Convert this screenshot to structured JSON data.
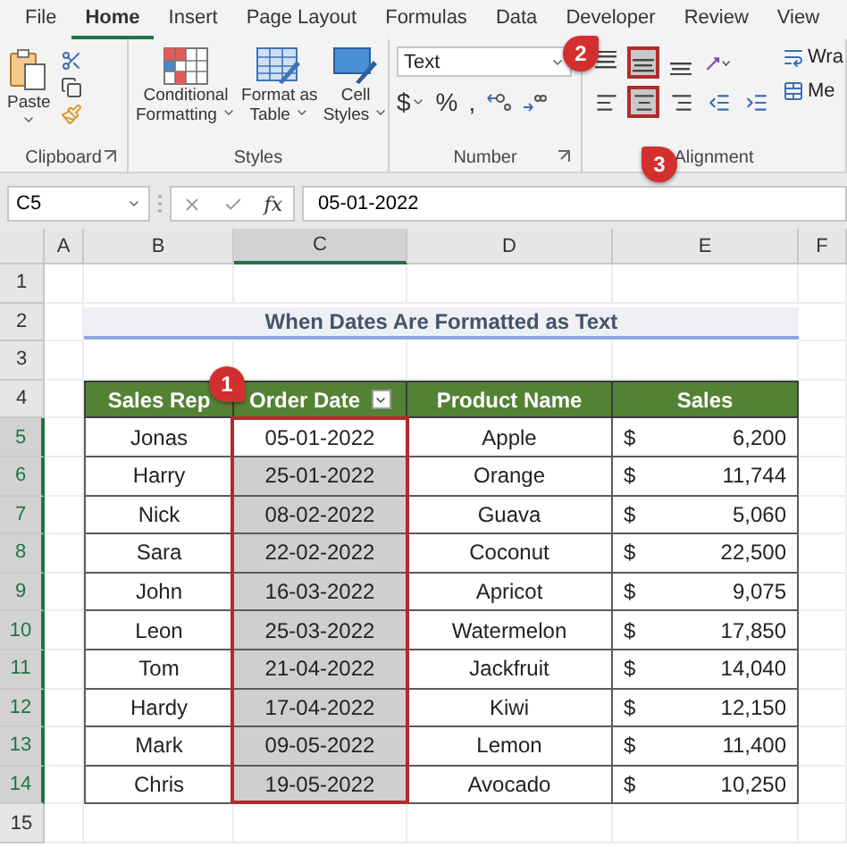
{
  "tabs": [
    {
      "label": "File",
      "selected": false
    },
    {
      "label": "Home",
      "selected": true
    },
    {
      "label": "Insert",
      "selected": false
    },
    {
      "label": "Page Layout",
      "selected": false
    },
    {
      "label": "Formulas",
      "selected": false
    },
    {
      "label": "Data",
      "selected": false
    },
    {
      "label": "Developer",
      "selected": false
    },
    {
      "label": "Review",
      "selected": false
    },
    {
      "label": "View",
      "selected": false
    }
  ],
  "ribbon": {
    "clipboard": {
      "paste": "Paste",
      "group_label": "Clipboard"
    },
    "styles": {
      "buttons": [
        {
          "kind": "conditional",
          "lines": [
            "Conditional",
            "Formatting"
          ]
        },
        {
          "kind": "table",
          "lines": [
            "Format as",
            "Table"
          ]
        },
        {
          "kind": "cell",
          "lines": [
            "Cell",
            "Styles"
          ]
        }
      ],
      "group_label": "Styles"
    },
    "number": {
      "format": "Text",
      "symbols": [
        {
          "text": "$",
          "caret": true
        },
        {
          "text": "%",
          "caret": false
        },
        {
          "text": ",",
          "caret": false
        }
      ],
      "group_label": "Number"
    },
    "alignment": {
      "top_row": [
        {
          "kind": "top",
          "highlighted": false
        },
        {
          "kind": "middle",
          "highlighted": true,
          "badge": "2"
        },
        {
          "kind": "bottom",
          "highlighted": false
        },
        {
          "kind": "orientation",
          "highlighted": false
        }
      ],
      "bottom_row": [
        {
          "kind": "left",
          "highlighted": false
        },
        {
          "kind": "center",
          "highlighted": true,
          "badge": "3"
        },
        {
          "kind": "right",
          "highlighted": false
        },
        {
          "kind": "outdent",
          "highlighted": false
        },
        {
          "kind": "indent",
          "highlighted": false
        }
      ],
      "wrap_text": "Wra",
      "merge": "Me",
      "group_label": "Alignment"
    }
  },
  "formula_bar": {
    "name_box": "C5",
    "function_label": "fx",
    "value": "05-01-2022"
  },
  "columns": [
    {
      "label": "A",
      "selected": false
    },
    {
      "label": "B",
      "selected": false
    },
    {
      "label": "C",
      "selected": true
    },
    {
      "label": "D",
      "selected": false
    },
    {
      "label": "E",
      "selected": false
    },
    {
      "label": "F",
      "selected": false
    }
  ],
  "row_numbers": [
    {
      "label": "1",
      "selected": false
    },
    {
      "label": "2",
      "selected": false
    },
    {
      "label": "3",
      "selected": false
    },
    {
      "label": "4",
      "selected": false
    },
    {
      "label": "5",
      "selected": true
    },
    {
      "label": "6",
      "selected": true
    },
    {
      "label": "7",
      "selected": true
    },
    {
      "label": "8",
      "selected": true
    },
    {
      "label": "9",
      "selected": true
    },
    {
      "label": "10",
      "selected": true
    },
    {
      "label": "11",
      "selected": true
    },
    {
      "label": "12",
      "selected": true
    },
    {
      "label": "13",
      "selected": true
    },
    {
      "label": "14",
      "selected": true
    },
    {
      "label": "15",
      "selected": false
    }
  ],
  "title": "When Dates Are Formatted as Text",
  "table": {
    "columns": [
      {
        "label": "Sales Rep",
        "filter": false
      },
      {
        "label": "Order Date",
        "filter": true
      },
      {
        "label": "Product Name",
        "filter": false
      },
      {
        "label": "Sales",
        "filter": false
      }
    ],
    "rows": [
      {
        "rep": "Jonas",
        "date": "05-01-2022",
        "selected": true,
        "active": true,
        "product": "Apple",
        "currency": "$",
        "amount": "6,200"
      },
      {
        "rep": "Harry",
        "date": "25-01-2022",
        "selected": true,
        "active": false,
        "product": "Orange",
        "currency": "$",
        "amount": "11,744"
      },
      {
        "rep": "Nick",
        "date": "08-02-2022",
        "selected": true,
        "active": false,
        "product": "Guava",
        "currency": "$",
        "amount": "5,060"
      },
      {
        "rep": "Sara",
        "date": "22-02-2022",
        "selected": true,
        "active": false,
        "product": "Coconut",
        "currency": "$",
        "amount": "22,500"
      },
      {
        "rep": "John",
        "date": "16-03-2022",
        "selected": true,
        "active": false,
        "product": "Apricot",
        "currency": "$",
        "amount": "9,075"
      },
      {
        "rep": "Leon",
        "date": "25-03-2022",
        "selected": true,
        "active": false,
        "product": "Watermelon",
        "currency": "$",
        "amount": "17,850"
      },
      {
        "rep": "Tom",
        "date": "21-04-2022",
        "selected": true,
        "active": false,
        "product": "Jackfruit",
        "currency": "$",
        "amount": "14,040"
      },
      {
        "rep": "Hardy",
        "date": "17-04-2022",
        "selected": true,
        "active": false,
        "product": "Kiwi",
        "currency": "$",
        "amount": "12,150"
      },
      {
        "rep": "Mark",
        "date": "09-05-2022",
        "selected": true,
        "active": false,
        "product": "Lemon",
        "currency": "$",
        "amount": "11,400"
      },
      {
        "rep": "Chris",
        "date": "19-05-2022",
        "selected": true,
        "active": false,
        "product": "Avocado",
        "currency": "$",
        "amount": "10,250"
      }
    ]
  },
  "selection_badge": "1"
}
